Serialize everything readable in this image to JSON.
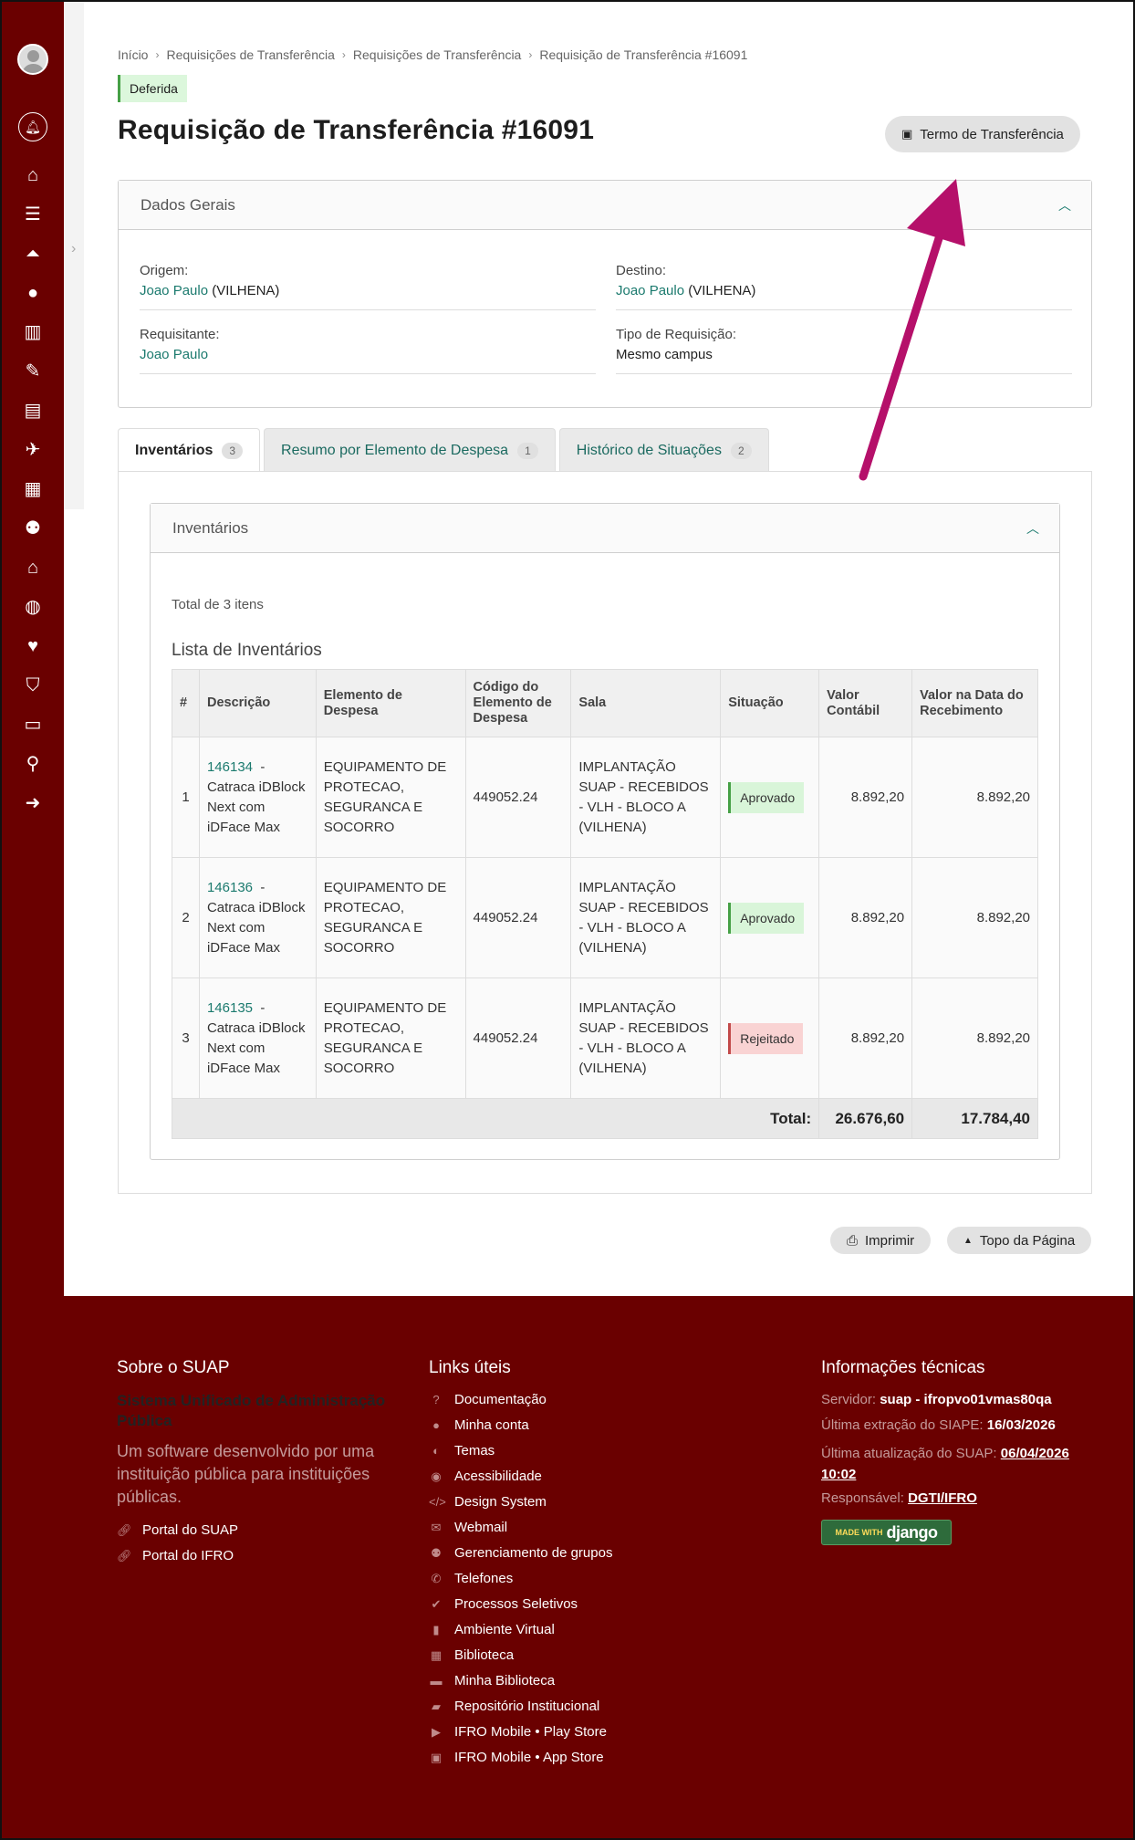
{
  "breadcrumb": {
    "items": [
      "Início",
      "Requisições de Transferência",
      "Requisições de Transferência",
      "Requisição de Transferência #16091"
    ]
  },
  "status_badge": "Deferida",
  "title": "Requisição de Transferência #16091",
  "termo_button": "Termo de Transferência",
  "dados_gerais": {
    "title": "Dados Gerais",
    "origem_label": "Origem:",
    "origem_name": "Joao Paulo",
    "origem_campus": "(VILHENA)",
    "destino_label": "Destino:",
    "destino_name": "Joao Paulo",
    "destino_campus": "(VILHENA)",
    "requisitante_label": "Requisitante:",
    "requisitante_name": "Joao Paulo",
    "tipo_label": "Tipo de Requisição:",
    "tipo_value": "Mesmo campus"
  },
  "tabs": [
    {
      "label": "Inventários",
      "count": "3"
    },
    {
      "label": "Resumo por Elemento de Despesa",
      "count": "1"
    },
    {
      "label": "Histórico de Situações",
      "count": "2"
    }
  ],
  "inventarios": {
    "title": "Inventários",
    "total_text": "Total de 3 itens",
    "list_title": "Lista de Inventários",
    "columns": [
      "#",
      "Descrição",
      "Elemento de Despesa",
      "Código do Elemento de Despesa",
      "Sala",
      "Situação",
      "Valor Contábil",
      "Valor na Data do Recebimento"
    ],
    "rows": [
      {
        "n": "1",
        "code": "146134",
        "desc": " - Catraca iDBlock Next com iDFace Max",
        "elemento": "EQUIPAMENTO DE PROTECAO, SEGURANCA E SOCORRO",
        "codigo": "449052.24",
        "sala": "IMPLANTAÇÃO SUAP - RECEBIDOS - VLH - BLOCO A (VILHENA)",
        "situacao": "Aprovado",
        "valor": "8.892,20",
        "valor_receb": "8.892,20"
      },
      {
        "n": "2",
        "code": "146136",
        "desc": " - Catraca iDBlock Next com iDFace Max",
        "elemento": "EQUIPAMENTO DE PROTECAO, SEGURANCA E SOCORRO",
        "codigo": "449052.24",
        "sala": "IMPLANTAÇÃO SUAP - RECEBIDOS - VLH - BLOCO A (VILHENA)",
        "situacao": "Aprovado",
        "valor": "8.892,20",
        "valor_receb": "8.892,20"
      },
      {
        "n": "3",
        "code": "146135",
        "desc": " - Catraca iDBlock Next com iDFace Max",
        "elemento": "EQUIPAMENTO DE PROTECAO, SEGURANCA E SOCORRO",
        "codigo": "449052.24",
        "sala": "IMPLANTAÇÃO SUAP - RECEBIDOS - VLH - BLOCO A (VILHENA)",
        "situacao": "Rejeitado",
        "valor": "8.892,20",
        "valor_receb": "8.892,20"
      }
    ],
    "total_label": "Total:",
    "total_contabil": "26.676,60",
    "total_receb": "17.784,40"
  },
  "actions": {
    "imprimir": "Imprimir",
    "topo": "Topo da Página"
  },
  "footer": {
    "sobre_title": "Sobre o SUAP",
    "sobre_name": "Sistema Unificado de Administração Pública",
    "sobre_desc": "Um software desenvolvido por uma instituição pública para instituições públicas.",
    "sobre_links": [
      "Portal do SUAP",
      "Portal do IFRO"
    ],
    "links_title": "Links úteis",
    "links": [
      {
        "label": "Documentação",
        "icon": "question-circle-icon"
      },
      {
        "label": "Minha conta",
        "icon": "user-icon"
      },
      {
        "label": "Temas",
        "icon": "palette-icon"
      },
      {
        "label": "Acessibilidade",
        "icon": "accessibility-icon"
      },
      {
        "label": "Design System",
        "icon": "code-icon"
      },
      {
        "label": "Webmail",
        "icon": "envelope-icon"
      },
      {
        "label": "Gerenciamento de grupos",
        "icon": "users-icon"
      },
      {
        "label": "Telefones",
        "icon": "phone-icon"
      },
      {
        "label": "Processos Seletivos",
        "icon": "check-circle-icon"
      },
      {
        "label": "Ambiente Virtual",
        "icon": "mouse-icon"
      },
      {
        "label": "Biblioteca",
        "icon": "library-icon"
      },
      {
        "label": "Minha Biblioteca",
        "icon": "book-icon"
      },
      {
        "label": "Repositório Institucional",
        "icon": "folder-icon"
      },
      {
        "label": "IFRO Mobile • Play Store",
        "icon": "play-icon"
      },
      {
        "label": "IFRO Mobile • App Store",
        "icon": "apple-icon"
      }
    ],
    "info_title": "Informações técnicas",
    "servidor_label": "Servidor:",
    "servidor_value": "suap - ifropvo01vmas80qa",
    "siape_label": "Última extração do SIAPE:",
    "siape_value": "16/03/2026",
    "suap_label": "Última atualização do SUAP:",
    "suap_value_date": "06/04/2026",
    "suap_value_time": "10:02",
    "resp_label": "Responsável:",
    "resp_value": "DGTI/IFRO",
    "django_made": "MADE WITH",
    "django_name": "django"
  },
  "colors": {
    "brand": "#6a0000",
    "link": "#1b7a6e",
    "annotation_arrow": "#b5106a"
  }
}
